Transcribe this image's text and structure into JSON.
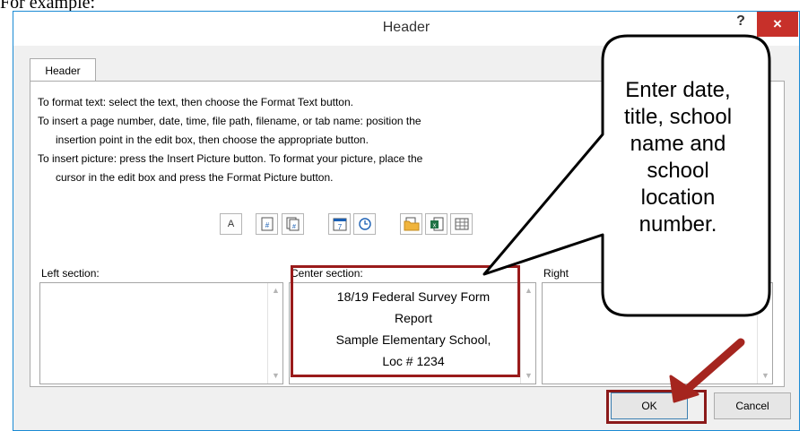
{
  "above_text": "For example:",
  "dialog": {
    "title": "Header",
    "help_label": "?",
    "close_label": "×",
    "tab_label": "Header",
    "instructions": [
      "To format text:  select the text, then choose the Format Text button.",
      "To insert a page number, date, time, file path, filename, or tab name:  position the",
      "insertion point in the edit box, then choose the appropriate button.",
      "To insert picture: press the Insert Picture button.  To format your picture, place the",
      "cursor in the edit box and press the Format Picture button."
    ],
    "toolbar_icons": [
      "format-text-icon",
      "page-number-icon",
      "number-of-pages-icon",
      "date-icon",
      "time-icon",
      "file-path-icon",
      "filename-icon",
      "sheet-name-icon"
    ],
    "format_text_label": "A",
    "left_section_label": "Left section:",
    "center_section_label": "Center section:",
    "right_section_label": "Right",
    "center_lines": [
      "18/19 Federal Survey  Form",
      "Report",
      "Sample Elementary School,",
      "Loc # 1234"
    ],
    "ok_label": "OK",
    "cancel_label": "Cancel"
  },
  "callout": {
    "text_lines": [
      "Enter date,",
      "title, school",
      "name and",
      "school",
      "location",
      "number."
    ]
  },
  "colors": {
    "accent": "#1a8ad4",
    "close": "#c7302a",
    "highlight": "#9a1b1b"
  }
}
